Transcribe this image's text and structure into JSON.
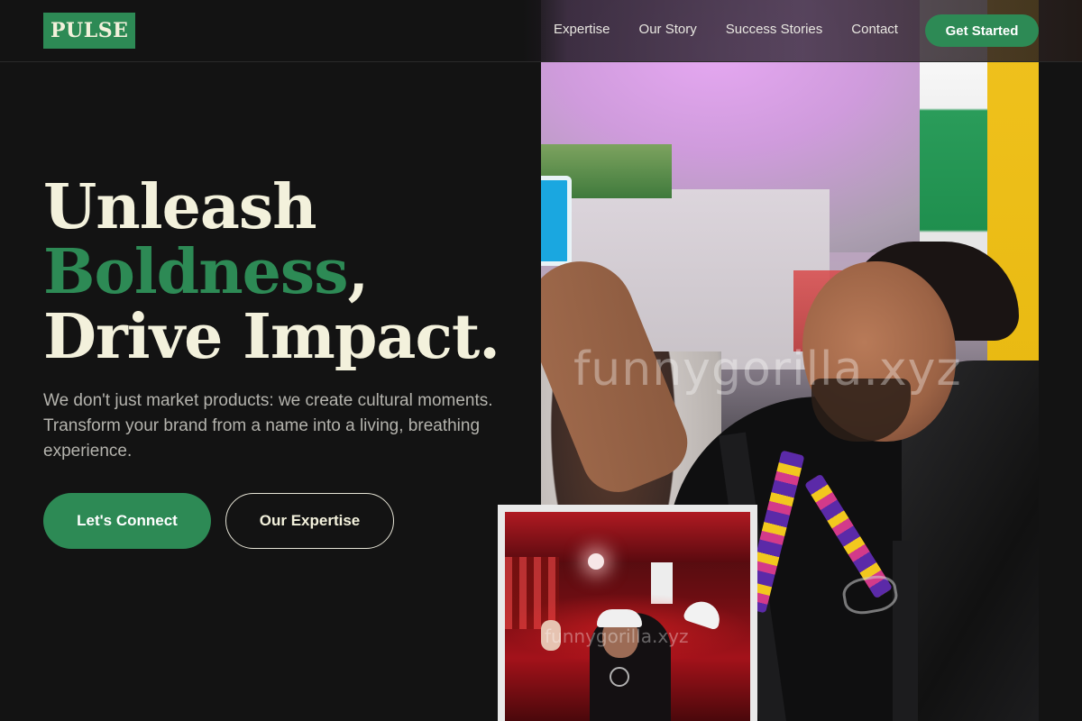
{
  "brand": {
    "logo_text": "PULSE",
    "accent_color": "#2d8a55",
    "text_cream": "#f3f1dc",
    "background": "#131313"
  },
  "nav": {
    "links": [
      "Expertise",
      "Our Story",
      "Success Stories",
      "Contact"
    ],
    "cta_label": "Get Started"
  },
  "hero": {
    "headline_line1": "Unleash",
    "headline_accent": "Boldness",
    "headline_comma": ",",
    "headline_line3": "Drive Impact.",
    "subcopy": "We don't just market products: we create cultural moments. Transform your brand from a name into a living, breathing experience.",
    "primary_button": "Let's Connect",
    "secondary_button": "Our Expertise"
  },
  "images": {
    "main_photo_watermark": "funnygorilla.xyz",
    "inset_photo_watermark": "funnygorilla.xyz"
  }
}
